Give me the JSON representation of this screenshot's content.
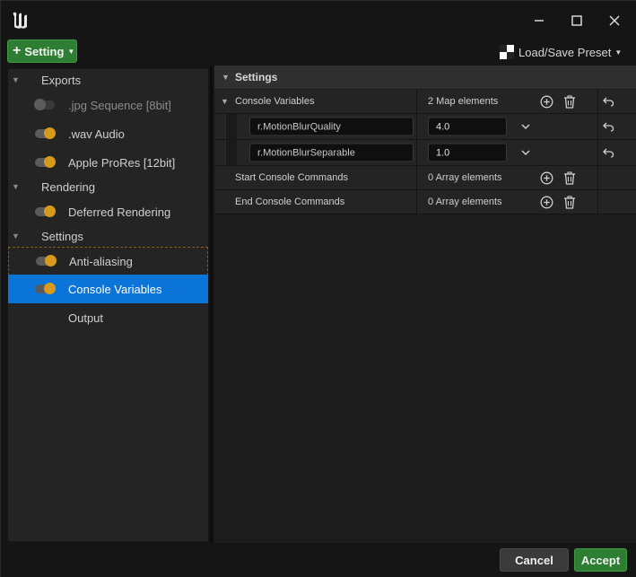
{
  "window": {
    "logo_icon": "unreal-engine-logo",
    "controls": [
      "minimize-icon",
      "maximize-icon",
      "close-icon"
    ]
  },
  "toolbar": {
    "setting_label": "Setting",
    "preset_label": "Load/Save Preset"
  },
  "tree": {
    "exports": {
      "label": "Exports",
      "items": [
        {
          "label": ".jpg Sequence [8bit]",
          "enabled": false
        },
        {
          "label": ".wav Audio",
          "enabled": true
        },
        {
          "label": "Apple ProRes [12bit]",
          "enabled": true
        }
      ]
    },
    "rendering": {
      "label": "Rendering",
      "items": [
        {
          "label": "Deferred Rendering",
          "enabled": true
        }
      ]
    },
    "settings": {
      "label": "Settings",
      "items": [
        {
          "label": "Anti-aliasing",
          "enabled": true
        },
        {
          "label": "Console Variables",
          "enabled": true,
          "selected": true
        },
        {
          "label": "Output"
        }
      ]
    }
  },
  "details": {
    "header": "Settings",
    "console_variables": {
      "label": "Console Variables",
      "summary": "2 Map elements",
      "entries": [
        {
          "key": "r.MotionBlurQuality",
          "value": "4.0"
        },
        {
          "key": "r.MotionBlurSeparable",
          "value": "1.0"
        }
      ]
    },
    "start_commands": {
      "label": "Start Console Commands",
      "summary": "0 Array elements"
    },
    "end_commands": {
      "label": "End Console Commands",
      "summary": "0 Array elements"
    }
  },
  "footer": {
    "cancel_label": "Cancel",
    "accept_label": "Accept"
  },
  "colors": {
    "accent_green": "#2d7d32",
    "selection_blue": "#0a74d8",
    "toggle_on": "#d89a1c"
  }
}
